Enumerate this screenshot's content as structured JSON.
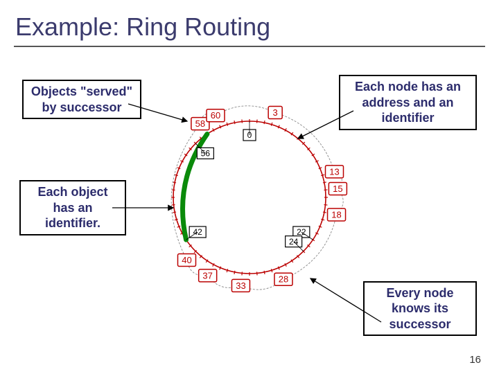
{
  "title": "Example: Ring Routing",
  "callouts": {
    "top_left": "Objects \"served\" by successor",
    "top_right": "Each node has an address and an identifier",
    "mid_left": "Each object has an identifier.",
    "bottom_right": "Every node knows its successor"
  },
  "page_number": "16",
  "ring": {
    "nodes": [
      3,
      13,
      15,
      18,
      28,
      33,
      37,
      40,
      58,
      60
    ],
    "objects": [
      0,
      22,
      24,
      42,
      56
    ],
    "modulus": 64
  },
  "chart_data": {
    "type": "diagram",
    "description": "Chord-style ring routing over identifier space mod 64. Red boxed numbers are nodes; unboxed or black-boxed numbers are object identifiers. Each node knows its successor (dashed outward arcs). Objects are served by their successor node on the ring. A green arc highlights objects 42 and 56 being routed toward node 58.",
    "identifier_space": 64,
    "nodes": [
      3,
      13,
      15,
      18,
      28,
      33,
      37,
      40,
      58,
      60
    ],
    "objects": [
      0,
      22,
      24,
      42,
      56
    ],
    "successor_edges": [
      [
        3,
        13
      ],
      [
        13,
        15
      ],
      [
        15,
        18
      ],
      [
        18,
        28
      ],
      [
        28,
        33
      ],
      [
        33,
        37
      ],
      [
        37,
        40
      ],
      [
        40,
        58
      ],
      [
        58,
        60
      ],
      [
        60,
        3
      ]
    ],
    "object_served_by": {
      "0": 3,
      "22": 28,
      "24": 28,
      "42": 58,
      "56": 58
    },
    "highlighted_arc": {
      "from_object": 42,
      "through_object": 56,
      "to_node": 58,
      "color": "#0a8a0a"
    },
    "annotations": [
      "Objects \"served\" by successor",
      "Each node has an address and an identifier",
      "Each object has an identifier.",
      "Every node knows its successor"
    ]
  }
}
